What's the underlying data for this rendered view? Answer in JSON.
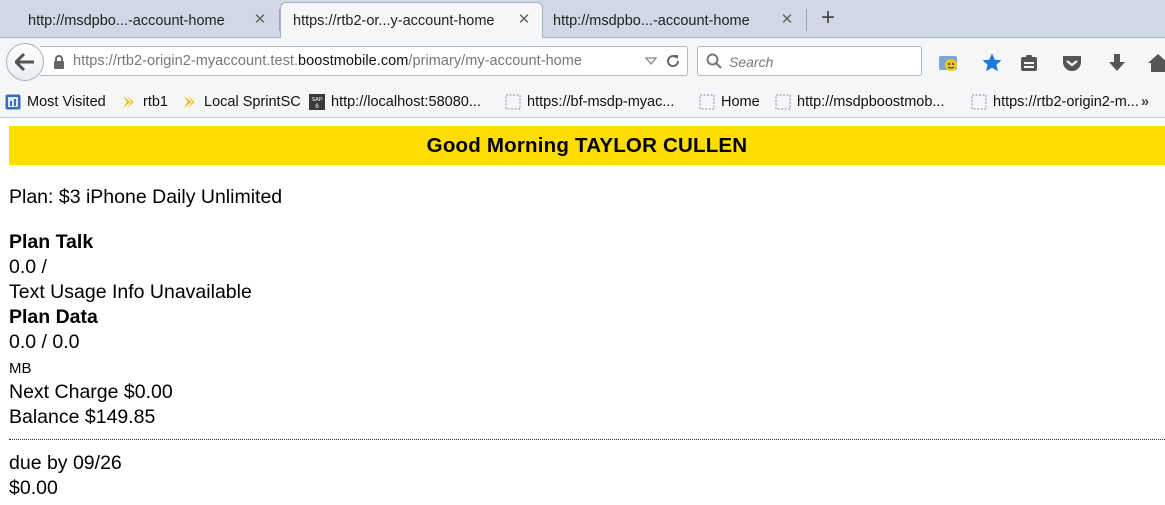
{
  "browser": {
    "tabs": [
      {
        "label": "http://msdpbo...-account-home",
        "active": false
      },
      {
        "label": "https://rtb2-or...y-account-home",
        "active": true
      },
      {
        "label": "http://msdpbo...-account-home",
        "active": false
      }
    ],
    "url": {
      "prefix": "https://rtb2-origin2-myaccount.test.",
      "domain": "boostmobile.com",
      "path": "/primary/my-account-home"
    },
    "search_placeholder": "Search",
    "bookmarks": [
      {
        "label": "Most Visited",
        "icon": "most-visited-icon"
      },
      {
        "label": "rtb1",
        "icon": "bookmark-arrow-icon"
      },
      {
        "label": "Local SprintSC",
        "icon": "bookmark-arrow-icon"
      },
      {
        "label": "http://localhost:58080...",
        "icon": "sap-icon"
      },
      {
        "label": "https://bf-msdp-myac...",
        "icon": "page-icon"
      },
      {
        "label": "Home",
        "icon": "page-icon"
      },
      {
        "label": "http://msdpboostmob...",
        "icon": "page-icon"
      },
      {
        "label": "https://rtb2-origin2-m...",
        "icon": "page-icon"
      }
    ]
  },
  "page": {
    "greeting": "Good Morning TAYLOR CULLEN",
    "plan": "Plan: $3 iPhone Daily Unlimited",
    "talk_heading": "Plan Talk",
    "talk_value": "0.0 /",
    "text_usage": "Text Usage Info Unavailable",
    "data_heading": "Plan Data",
    "data_value": "0.0 / 0.0",
    "data_unit": "MB",
    "next_charge": "Next Charge $0.00",
    "balance": "Balance $149.85",
    "due_by": "due by 09/26",
    "due_amount": "$0.00"
  },
  "colors": {
    "greeting_bar": "#ffdd00",
    "tab_strip": "#cfd8e4",
    "toolbar": "#f5f6f7",
    "star_accent": "#1c7ad8"
  }
}
